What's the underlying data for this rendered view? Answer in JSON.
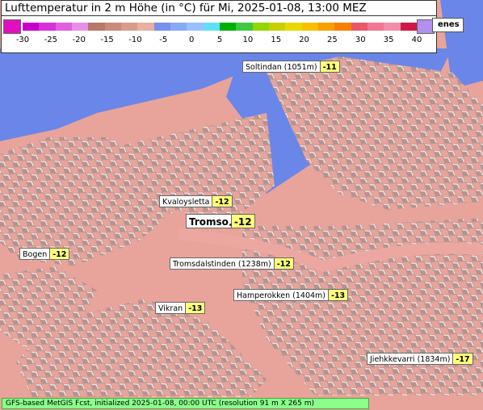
{
  "title": "Lufttemperatur in 2 m Höhe (in °C) für Mi, 2025-01-08, 13:00 MEZ",
  "legend": {
    "ticks": [
      "-30",
      "-25",
      "-20",
      "-15",
      "-10",
      "-5",
      "0",
      "5",
      "10",
      "15",
      "20",
      "25",
      "30",
      "35",
      "40"
    ],
    "low_cap_color": "#e010c0",
    "high_cap_color": "#b090f0",
    "colors": [
      "#c800c8",
      "#d830d8",
      "#e060e0",
      "#e890e8",
      "#b87868",
      "#c88a7a",
      "#d89c8c",
      "#e8b0a0",
      "#7890f0",
      "#88a8f8",
      "#98c0ff",
      "#60e0f8",
      "#00b000",
      "#40c840",
      "#90d800",
      "#c8d000",
      "#e8d800",
      "#f8c000",
      "#f8a000",
      "#f88000",
      "#e85868",
      "#f07890",
      "#f090a8",
      "#d01848"
    ]
  },
  "partial_label": "enes",
  "places": [
    {
      "name": "Soltindan (1051m)",
      "value": "-11"
    },
    {
      "name": "Kvaloysletta",
      "value": "-12"
    },
    {
      "name": "Tromso",
      "value": "-12"
    },
    {
      "name": "Bogen",
      "value": "-12"
    },
    {
      "name": "Tromsdalstinden (1238m)",
      "value": "-12"
    },
    {
      "name": "Hamperokken (1404m)",
      "value": "-13"
    },
    {
      "name": "Vikran",
      "value": "-13"
    },
    {
      "name": "Jiehkkevarri (1834m)",
      "value": "-17"
    }
  ],
  "colors": {
    "sea": "#6a86e8",
    "land": "#e8a49a",
    "shadow": "#9a8a8a",
    "snow": "#f4e4e0"
  },
  "footer": "GFS-based MetGIS Fcst, initialized 2025-01-08, 00:00 UTC  (resolution 91 m X 265 m)"
}
